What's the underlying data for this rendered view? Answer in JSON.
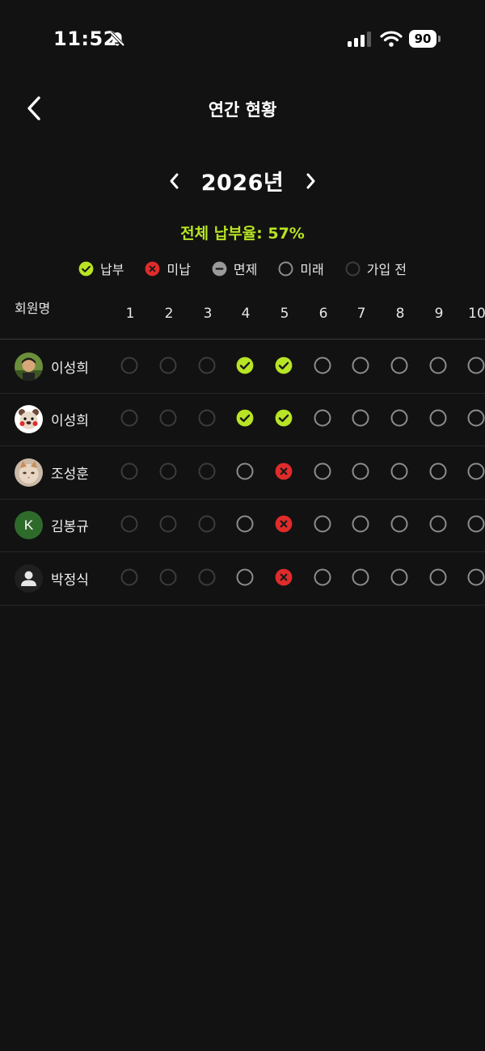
{
  "status_bar": {
    "time": "11:52",
    "battery": "90"
  },
  "nav": {
    "title": "연간 현황"
  },
  "year": {
    "label": "2026년"
  },
  "summary": {
    "rate_text": "전체 납부율: 57%"
  },
  "legend": [
    {
      "status": "paid",
      "label": "납부"
    },
    {
      "status": "unpaid",
      "label": "미납"
    },
    {
      "status": "exempt",
      "label": "면제"
    },
    {
      "status": "future",
      "label": "미래"
    },
    {
      "status": "before",
      "label": "가입 전"
    }
  ],
  "table": {
    "member_header": "회원명",
    "months": [
      "1",
      "2",
      "3",
      "4",
      "5",
      "6",
      "7",
      "8",
      "9",
      "10"
    ],
    "members": [
      {
        "name": "이성희",
        "avatar": "photo-boy",
        "statuses": [
          "before",
          "before",
          "before",
          "paid",
          "paid",
          "future",
          "future",
          "future",
          "future",
          "future"
        ]
      },
      {
        "name": "이성희",
        "avatar": "cartoon-bear",
        "statuses": [
          "before",
          "before",
          "before",
          "paid",
          "paid",
          "future",
          "future",
          "future",
          "future",
          "future"
        ]
      },
      {
        "name": "조성훈",
        "avatar": "photo-cat",
        "statuses": [
          "before",
          "before",
          "before",
          "future",
          "unpaid",
          "future",
          "future",
          "future",
          "future",
          "future"
        ]
      },
      {
        "name": "김봉규",
        "avatar": "initial",
        "initial": "K",
        "statuses": [
          "before",
          "before",
          "before",
          "future",
          "unpaid",
          "future",
          "future",
          "future",
          "future",
          "future"
        ]
      },
      {
        "name": "박정식",
        "avatar": "default-person",
        "statuses": [
          "before",
          "before",
          "before",
          "future",
          "unpaid",
          "future",
          "future",
          "future",
          "future",
          "future"
        ]
      }
    ]
  },
  "colors": {
    "accent_green": "#b8e425",
    "paid": "#b8e425",
    "unpaid": "#e02b2b",
    "exempt": "#9a9a9a",
    "future_ring": "#8c8c8c",
    "before_ring": "#3c3c3c",
    "background": "#121212"
  }
}
